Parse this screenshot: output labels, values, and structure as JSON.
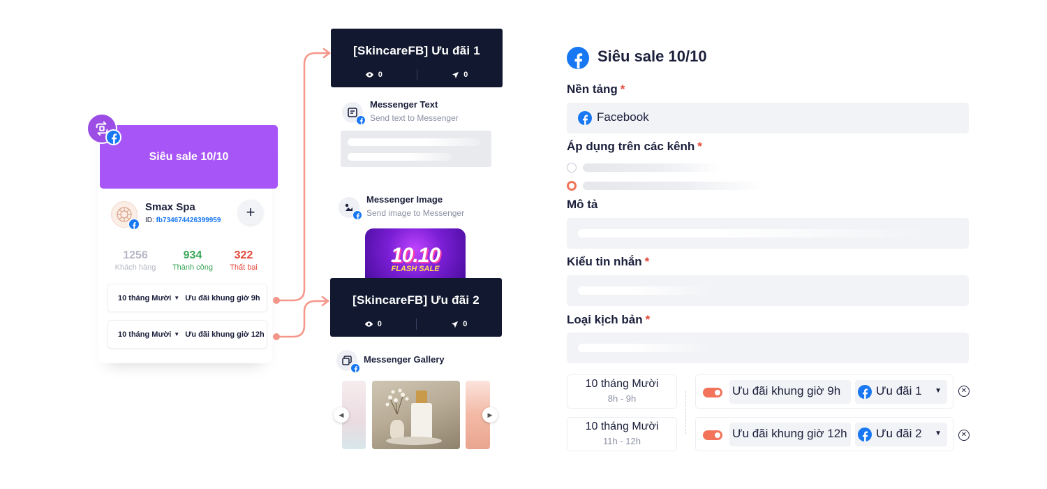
{
  "campaign": {
    "title": "Siêu sale 10/10",
    "page_name": "Smax Spa",
    "page_id_label": "ID:",
    "page_id_value": "fb734674426399959",
    "add_label": "+",
    "stats": [
      {
        "value": "1256",
        "label": "Khách hàng"
      },
      {
        "value": "934",
        "label": "Thành công"
      },
      {
        "value": "322",
        "label": "Thất bại"
      }
    ],
    "slots": [
      {
        "day": "10 tháng Mười",
        "offer": "Ưu đãi khung giờ 9h"
      },
      {
        "day": "10 tháng Mười",
        "offer": "Ưu đãi khung giờ 12h"
      }
    ]
  },
  "flow": {
    "card1": {
      "title": "[SkincareFB] Ưu đãi 1",
      "views": "0",
      "sent": "0"
    },
    "card2": {
      "title": "[SkincareFB] Ưu đãi 2",
      "views": "0",
      "sent": "0"
    },
    "text_block": {
      "title": "Messenger Text",
      "subtitle": "Send text to Messenger"
    },
    "image_block": {
      "title": "Messenger Image",
      "subtitle": "Send image to Messenger",
      "promo_big": "10.10",
      "promo_small": "FLASH SALE"
    },
    "gallery_block": {
      "title": "Messenger Gallery"
    }
  },
  "form": {
    "title": "Siêu sale 10/10",
    "platform_label": "Nền tảng",
    "platform_value": "Facebook",
    "channels_label": "Áp dụng trên các kênh",
    "description_label": "Mô tả",
    "message_type_label": "Kiểu tin nhắn",
    "script_type_label": "Loại kịch bản",
    "required_mark": "*",
    "schedule": [
      {
        "day": "10 tháng Mười",
        "hours": "8h - 9h",
        "slot_name": "Ưu đãi khung giờ 9h",
        "selected": "Ưu đãi 1",
        "enabled": true
      },
      {
        "day": "10 tháng Mười",
        "hours": "11h - 12h",
        "slot_name": "Ưu đãi khung giờ 12h",
        "selected": "Ưu đãi 2",
        "enabled": true
      }
    ]
  },
  "colors": {
    "accent_purple": "#a855f7",
    "dark_navy": "#11182f",
    "facebook_blue": "#1877f2",
    "coral": "#f2735a",
    "success_green": "#3aa757",
    "fail_red": "#e4483a"
  }
}
